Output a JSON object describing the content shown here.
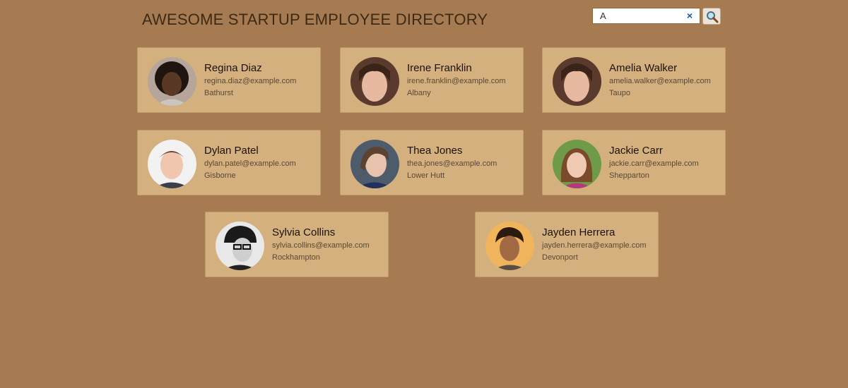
{
  "header": {
    "title": "AWESOME STARTUP EMPLOYEE DIRECTORY"
  },
  "search": {
    "value": "A",
    "clear_icon": "×",
    "clear_icon_name": "close-icon",
    "button_icon_name": "magnifier-icon"
  },
  "employees": [
    {
      "name": "Regina Diaz",
      "email": "regina.diaz@example.com",
      "city": "Bathurst"
    },
    {
      "name": "Irene Franklin",
      "email": "irene.franklin@example.com",
      "city": "Albany"
    },
    {
      "name": "Amelia Walker",
      "email": "amelia.walker@example.com",
      "city": "Taupo"
    },
    {
      "name": "Dylan Patel",
      "email": "dylan.patel@example.com",
      "city": "Gisborne"
    },
    {
      "name": "Thea Jones",
      "email": "thea.jones@example.com",
      "city": "Lower Hutt"
    },
    {
      "name": "Jackie Carr",
      "email": "jackie.carr@example.com",
      "city": "Shepparton"
    },
    {
      "name": "Sylvia Collins",
      "email": "sylvia.collins@example.com",
      "city": "Rockhampton"
    },
    {
      "name": "Jayden Herrera",
      "email": "jayden.herrera@example.com",
      "city": "Devonport"
    }
  ],
  "colors": {
    "page_background": "#a67b52",
    "card_background": "#d4b07e",
    "title_text": "#3d2a14",
    "clear_icon": "#1a56a8"
  }
}
